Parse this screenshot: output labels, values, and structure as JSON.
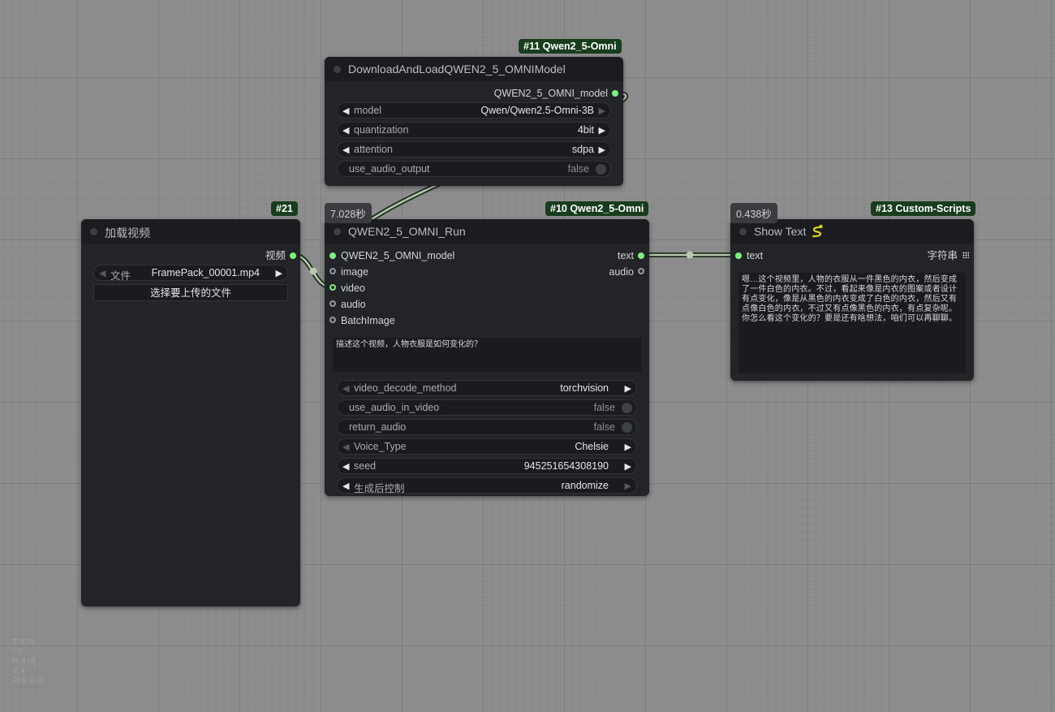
{
  "nodes": {
    "download": {
      "badge": "#11 Qwen2_5-Omni",
      "title": "DownloadAndLoadQWEN2_5_OMNIModel",
      "output": "QWEN2_5_OMNI_model",
      "widgets": {
        "model": {
          "label": "model",
          "value": "Qwen/Qwen2.5-Omni-3B"
        },
        "quantization": {
          "label": "quantization",
          "value": "4bit"
        },
        "attention": {
          "label": "attention",
          "value": "sdpa"
        },
        "use_audio_output": {
          "label": "use_audio_output",
          "value": "false"
        }
      }
    },
    "load_video": {
      "badge": "#21",
      "title": "加载视频",
      "output": "视频",
      "file_label": "文件",
      "file_value": "FramePack_00001.mp4",
      "upload_button": "选择要上传的文件"
    },
    "run": {
      "time": "7.028秒",
      "badge": "#10 Qwen2_5-Omni",
      "title": "QWEN2_5_OMNI_Run",
      "inputs": [
        "QWEN2_5_OMNI_model",
        "image",
        "video",
        "audio",
        "BatchImage"
      ],
      "outputs": [
        "text",
        "audio"
      ],
      "prompt": "描述这个视频，人物衣服是如何变化的？",
      "widgets": {
        "video_decode_method": {
          "label": "video_decode_method",
          "value": "torchvision"
        },
        "use_audio_in_video": {
          "label": "use_audio_in_video",
          "value": "false"
        },
        "return_audio": {
          "label": "return_audio",
          "value": "false"
        },
        "voice_type": {
          "label": "Voice_Type",
          "value": "Chelsie"
        },
        "seed": {
          "label": "seed",
          "value": "945251654308190"
        },
        "control_after_generate": {
          "label": "生成后控制",
          "value": "randomize"
        }
      }
    },
    "show_text": {
      "time": "0.438秒",
      "badge": "#13 Custom-Scripts",
      "title": "Show Text",
      "title_icon": "snake-icon",
      "input": "text",
      "output": "字符串",
      "text": "嗯…这个视频里，人物的衣服从一件黑色的内衣，然后变成了一件白色的内衣。不过，看起来像是内衣的图案或者设计有点变化，像是从黑色的内衣变成了白色的内衣，然后又有点像白色的内衣，不过又有点像黑色的内衣，有点复杂呢。你怎么看这个变化的？要是还有啥想法，咱们可以再聊聊。"
    }
  },
  "colors": {
    "canvas": "#8d8d8d",
    "node_body": "#222428",
    "node_header": "#1a1c20",
    "badge_bg": "#173d1d",
    "slot_connected": "#7cf27c",
    "link": "#b8c9b0"
  },
  "stats": [
    "T: 0.00",
    "I: 0",
    "N: 4 [4]",
    "V: 4",
    "FPS: 0.00"
  ]
}
